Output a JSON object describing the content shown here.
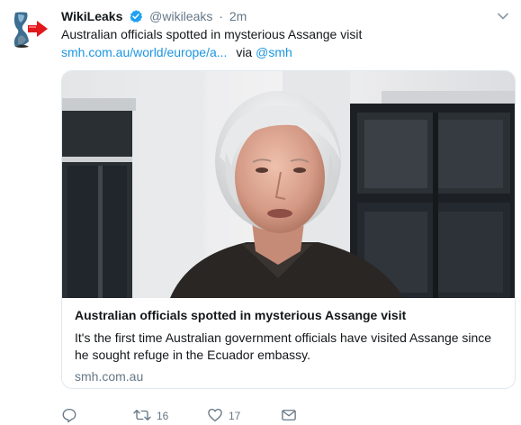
{
  "tweet": {
    "name": "WikiLeaks",
    "handle": "@wikileaks",
    "separator": "·",
    "time": "2m",
    "text": "Australian officials spotted in mysterious Assange visit",
    "link": "smh.com.au/world/europe/a...",
    "via": "via",
    "via_mention": "@smh",
    "colors": {
      "link": "#1b95e0",
      "muted": "#657786",
      "verified": "#1da1f2",
      "border": "#e1e8ed",
      "avatar_arrow": "#e0171b"
    }
  },
  "card": {
    "image": "man-speaking-at-window-photo",
    "title": "Australian officials spotted in mysterious Assange visit",
    "description": "It's the first time Australian government officials have visited Assange since he sought refuge in the Ecuador embassy.",
    "domain": "smh.com.au"
  },
  "actions": {
    "reply": {
      "icon": "reply-icon"
    },
    "retweet": {
      "icon": "retweet-icon",
      "count": "16"
    },
    "like": {
      "icon": "heart-icon",
      "count": "17"
    },
    "message": {
      "icon": "envelope-icon"
    }
  }
}
